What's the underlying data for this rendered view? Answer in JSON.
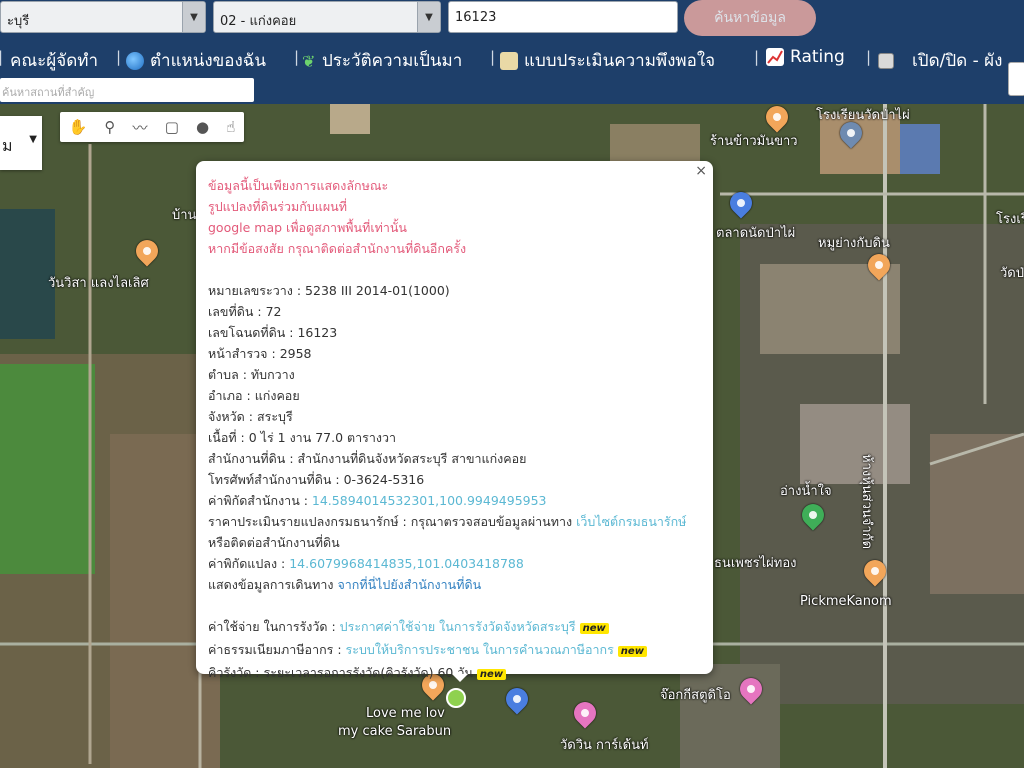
{
  "topbar": {
    "province_select": "ะบุรี",
    "district_select": "02 - แก่งคอย",
    "parcel_input": "16123",
    "search_button": "ค้นหาข้อมูล"
  },
  "menu": {
    "items": [
      {
        "label": "คณะผู้จัดทำ",
        "icon": "team-icon"
      },
      {
        "label": "ตำแหน่งของฉัน",
        "icon": "globe-icon"
      },
      {
        "label": "ประวัติความเป็นมา",
        "icon": "sprout-icon"
      },
      {
        "label": "แบบประเมินความพึงพอใจ",
        "icon": "form-icon"
      },
      {
        "label": "Rating",
        "icon": "chart-icon"
      },
      {
        "label": "เปิด/ปิด - ผัง",
        "icon": "checkbox-icon"
      }
    ],
    "separator": "|",
    "sub_input_placeholder": "ค้นหาสถานที่สำคัญ"
  },
  "map": {
    "maptype_label": "ม",
    "tools": [
      "hand-icon",
      "marker-icon",
      "polyline-icon",
      "rectangle-icon",
      "circle-icon",
      "hand-pointer-icon"
    ],
    "places": [
      {
        "name": "บ้าน"
      },
      {
        "name": "วันวิสา แลงไลเลิศ"
      },
      {
        "name": "ร้านข้าวมันขาว"
      },
      {
        "name": "ตลาดนัดป่าไผ่"
      },
      {
        "name": "หมูย่างกับดิน"
      },
      {
        "name": "วัดป่"
      },
      {
        "name": "อ่างน้ำใจ"
      },
      {
        "name": "ห้างหุ้นส่วนจำกัด"
      },
      {
        "name": "ธนเพชรไผ่ทอง"
      },
      {
        "name": "PickmeKanom"
      },
      {
        "name": "Love me lov"
      },
      {
        "name": "my cake Sarabun"
      },
      {
        "name": "วัดวิน การ์เด้นท์"
      },
      {
        "name": "จ๊อกกีสตูดิโอ"
      },
      {
        "name": "โรงเรียนวัดป่าไผ่"
      },
      {
        "name": "โรงเรียน"
      }
    ]
  },
  "popup": {
    "disclaimer": [
      "ข้อมูลนี้เป็นเพียงการแสดงลักษณะ",
      "รูปแปลงที่ดินร่วมกับแผนที่",
      "google map เพื่อดูสภาพพื้นที่เท่านั้น",
      "หากมีข้อสงสัย กรุณาติดต่อสำนักงานที่ดินอีกครั้ง"
    ],
    "fields": [
      {
        "label": "หมายเลขระวาง",
        "value": "5238 III 2014-01(1000)"
      },
      {
        "label": "เลขที่ดิน",
        "value": "72"
      },
      {
        "label": "เลขโฉนดที่ดิน",
        "value": "16123"
      },
      {
        "label": "หน้าสำรวจ",
        "value": "2958"
      },
      {
        "label": "ตำบล",
        "value": "ทับกวาง"
      },
      {
        "label": "อำเภอ",
        "value": "แก่งคอย"
      },
      {
        "label": "จังหวัด",
        "value": "สระบุรี"
      },
      {
        "label": "เนื้อที่",
        "value": "0 ไร่ 1 งาน 77.0 ตารางวา"
      },
      {
        "label": "สำนักงานที่ดิน",
        "value": "สำนักงานที่ดินจังหวัดสระบุรี สาขาแก่งคอย"
      },
      {
        "label": "โทรศัพท์สำนักงานที่ดิน",
        "value": "0-3624-5316"
      }
    ],
    "office_coord_label": "ค่าพิกัดสำนักงาน : ",
    "office_coord": "14.5894014532301,100.9949495953",
    "appraisal_label": "ราคาประเมินรายแปลงกรมธนารักษ์ : กรุณาตรวจสอบข้อมูลผ่านทาง ",
    "appraisal_link": "เว็บไซต์กรมธนารักษ์",
    "appraisal_tail": "หรือติดต่อสำนักงานที่ดิน",
    "parcel_coord_label": "ค่าพิกัดแปลง : ",
    "parcel_coord": "14.6079968414835,101.0403418788",
    "route_label": "แสดงข้อมูลการเดินทาง ",
    "route_link": "จากที่นี่ไปยังสำนักงานที่ดิน",
    "survey_cost_label": "ค่าใช้จ่าย ในการรังวัด : ",
    "survey_cost_link": "ประกาศค่าใช้จ่าย ในการรังวัดจังหวัดสระบุรี",
    "fee_label": "ค่าธรรมเนียมภาษีอากร : ",
    "fee_link": "ระบบให้บริการประชาชน ในการคำนวณภาษีอากร",
    "queue_label": "คิวรังวัด : ระยะเวลารอการรังวัด(คิวรังวัด) 60 วัน",
    "new_badge": "new",
    "close": "×"
  }
}
